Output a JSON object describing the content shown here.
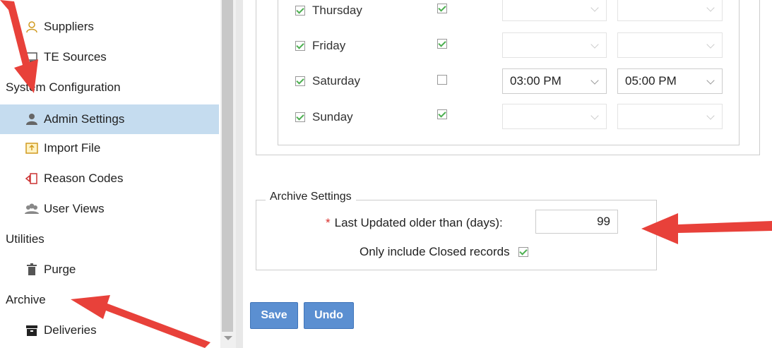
{
  "sidebar": {
    "items": [
      {
        "label": "Suppliers",
        "icon": "user-outline-icon"
      },
      {
        "label": "TE Sources",
        "icon": "monitor-icon"
      },
      {
        "label": "System Configuration",
        "type": "header"
      },
      {
        "label": "Admin Settings",
        "icon": "user-admin-icon",
        "active": true
      },
      {
        "label": "Import File",
        "icon": "import-icon"
      },
      {
        "label": "Reason Codes",
        "icon": "reason-code-icon"
      },
      {
        "label": "User Views",
        "icon": "users-icon"
      },
      {
        "label": "Utilities",
        "type": "header"
      },
      {
        "label": "Purge",
        "icon": "trash-icon"
      },
      {
        "label": "Archive",
        "type": "header"
      },
      {
        "label": "Deliveries",
        "icon": "archive-box-icon"
      }
    ]
  },
  "schedule": {
    "days": [
      {
        "day": "Thursday",
        "enabled": true,
        "closed": true,
        "start": "",
        "end": ""
      },
      {
        "day": "Friday",
        "enabled": true,
        "closed": true,
        "start": "",
        "end": ""
      },
      {
        "day": "Saturday",
        "enabled": true,
        "closed": false,
        "start": "03:00 PM",
        "end": "05:00 PM"
      },
      {
        "day": "Sunday",
        "enabled": true,
        "closed": true,
        "start": "",
        "end": ""
      }
    ]
  },
  "archive": {
    "legend": "Archive Settings",
    "required_mark": "*",
    "last_updated_label": "Last Updated older than (days):",
    "last_updated_value": "99",
    "closed_only_label": "Only include Closed records",
    "closed_only_checked": true
  },
  "buttons": {
    "save": "Save",
    "undo": "Undo"
  },
  "colors": {
    "accent": "#5b8fd1",
    "active_item": "#c5dcef",
    "arrow": "#e8413a",
    "check": "#4caf50",
    "required": "#d9302c"
  }
}
